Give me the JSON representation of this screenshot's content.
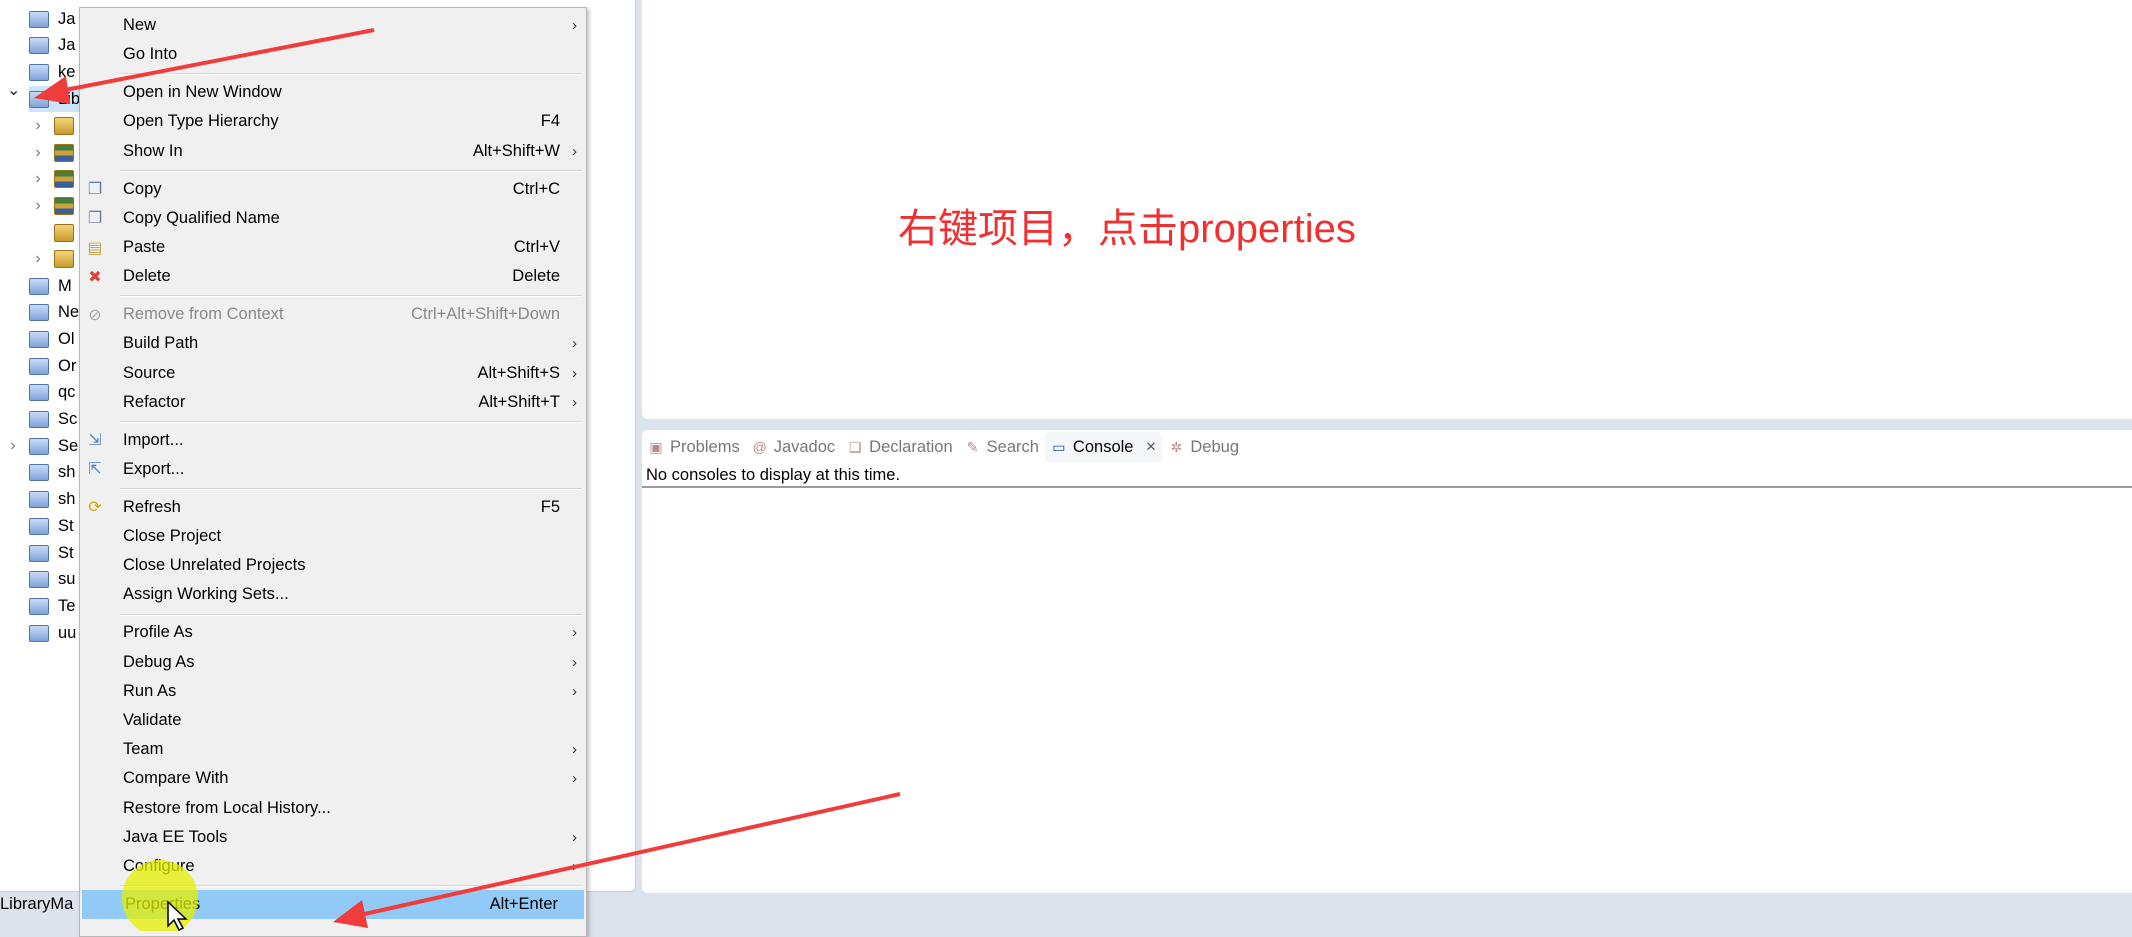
{
  "explorer": {
    "rows": [
      {
        "label": "Ja",
        "type": "folder"
      },
      {
        "label": "Ja",
        "type": "folder"
      },
      {
        "label": "ke",
        "type": "folder"
      },
      {
        "label": "Lib",
        "type": "project",
        "expanded": true,
        "selected": true
      },
      {
        "label": "",
        "type": "package",
        "child": true,
        "chevron": true
      },
      {
        "label": "",
        "type": "books",
        "child": true,
        "chevron": true
      },
      {
        "label": "",
        "type": "books",
        "child": true,
        "chevron": true
      },
      {
        "label": "",
        "type": "books",
        "child": true,
        "chevron": true
      },
      {
        "label": "",
        "type": "package",
        "child": true,
        "chevron": false
      },
      {
        "label": "",
        "type": "package",
        "child": true,
        "chevron": true
      },
      {
        "label": "M",
        "type": "folder"
      },
      {
        "label": "Ne",
        "type": "folder"
      },
      {
        "label": "Ol",
        "type": "folder"
      },
      {
        "label": "Or",
        "type": "folder"
      },
      {
        "label": "qc",
        "type": "folder"
      },
      {
        "label": "Sc",
        "type": "folder"
      },
      {
        "label": "Se",
        "type": "open-folder",
        "chevron": true
      },
      {
        "label": "sh",
        "type": "folder"
      },
      {
        "label": "sh",
        "type": "folder"
      },
      {
        "label": "St",
        "type": "folder"
      },
      {
        "label": "St",
        "type": "folder"
      },
      {
        "label": "su",
        "type": "folder"
      },
      {
        "label": "Te",
        "type": "folder"
      },
      {
        "label": "uu",
        "type": "folder"
      }
    ]
  },
  "status_bar": {
    "text": "LibraryMa"
  },
  "annotation": {
    "text": "右键项目，点击properties",
    "color": "#f03030"
  },
  "console": {
    "tabs": [
      {
        "label": "Problems",
        "icon": "problems-icon"
      },
      {
        "label": "Javadoc",
        "icon": "at-icon"
      },
      {
        "label": "Declaration",
        "icon": "declaration-icon"
      },
      {
        "label": "Search",
        "icon": "search-icon"
      },
      {
        "label": "Console",
        "icon": "console-icon",
        "active": true
      },
      {
        "label": "Debug",
        "icon": "debug-icon"
      }
    ],
    "message": "No consoles to display at this time."
  },
  "context_menu": {
    "items": [
      {
        "label": "New",
        "submenu": true
      },
      {
        "label": "Go Into"
      },
      {
        "sep": true
      },
      {
        "label": "Open in New Window"
      },
      {
        "label": "Open Type Hierarchy",
        "shortcut": "F4"
      },
      {
        "label": "Show In",
        "shortcut": "Alt+Shift+W",
        "submenu": true
      },
      {
        "sep": true
      },
      {
        "label": "Copy",
        "shortcut": "Ctrl+C",
        "icon": "copy-icon"
      },
      {
        "label": "Copy Qualified Name",
        "icon": "copy-qualified-icon"
      },
      {
        "label": "Paste",
        "shortcut": "Ctrl+V",
        "icon": "paste-icon"
      },
      {
        "label": "Delete",
        "shortcut": "Delete",
        "icon": "delete-icon"
      },
      {
        "sep": true
      },
      {
        "label": "Remove from Context",
        "shortcut": "Ctrl+Alt+Shift+Down",
        "disabled": true,
        "icon": "remove-context-icon"
      },
      {
        "label": "Build Path",
        "submenu": true
      },
      {
        "label": "Source",
        "shortcut": "Alt+Shift+S",
        "submenu": true
      },
      {
        "label": "Refactor",
        "shortcut": "Alt+Shift+T",
        "submenu": true
      },
      {
        "sep": true
      },
      {
        "label": "Import...",
        "icon": "import-icon"
      },
      {
        "label": "Export...",
        "icon": "export-icon"
      },
      {
        "sep": true
      },
      {
        "label": "Refresh",
        "shortcut": "F5",
        "icon": "refresh-icon"
      },
      {
        "label": "Close Project"
      },
      {
        "label": "Close Unrelated Projects"
      },
      {
        "label": "Assign Working Sets..."
      },
      {
        "sep": true
      },
      {
        "label": "Profile As",
        "submenu": true
      },
      {
        "label": "Debug As",
        "submenu": true
      },
      {
        "label": "Run As",
        "submenu": true
      },
      {
        "label": "Validate"
      },
      {
        "label": "Team",
        "submenu": true
      },
      {
        "label": "Compare With",
        "submenu": true
      },
      {
        "label": "Restore from Local History..."
      },
      {
        "label": "Java EE Tools",
        "submenu": true
      },
      {
        "label": "Configure",
        "submenu": true
      },
      {
        "sep": true
      },
      {
        "label": "Properties",
        "shortcut": "Alt+Enter",
        "highlighted": true
      }
    ]
  },
  "colors": {
    "menu_highlight": "#91c9f7",
    "arrow": "#f03c3c",
    "cursor_highlight": "#e6f000"
  }
}
